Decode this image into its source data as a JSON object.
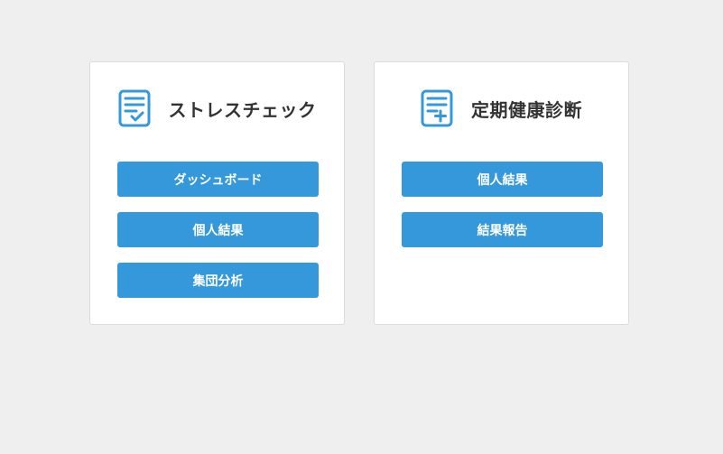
{
  "colors": {
    "background": "#efefef",
    "card": "#ffffff",
    "accent": "#3498db",
    "title_text": "#333333",
    "button_text": "#ffffff"
  },
  "stress_check": {
    "icon": "clipboard-check-icon",
    "title": "ストレスチェック",
    "buttons": [
      "ダッシュボード",
      "個人結果",
      "集団分析"
    ]
  },
  "health_checkup": {
    "icon": "clipboard-plus-icon",
    "title": "定期健康診断",
    "buttons": [
      "個人結果",
      "結果報告"
    ]
  }
}
